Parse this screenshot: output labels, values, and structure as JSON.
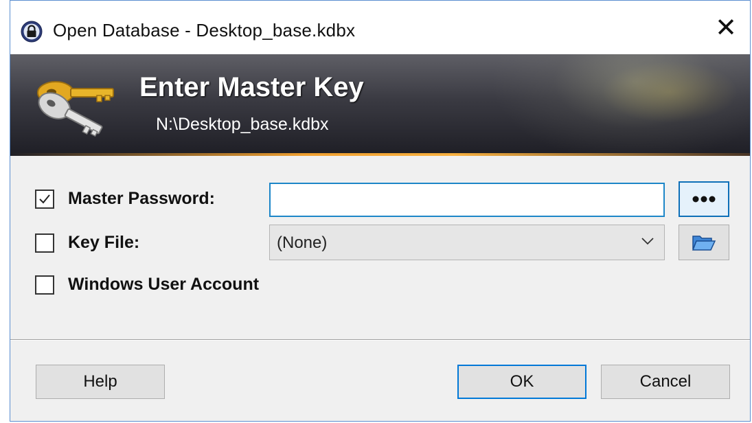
{
  "window": {
    "title": "Open Database - Desktop_base.kdbx",
    "close_glyph": "✕"
  },
  "banner": {
    "heading": "Enter Master Key",
    "path": "N:\\Desktop_base.kdbx"
  },
  "fields": {
    "master_password": {
      "label": "Master Password:",
      "checked": true,
      "value": "",
      "reveal_icon": "dots-icon"
    },
    "key_file": {
      "label": "Key File:",
      "checked": false,
      "selected": "(None)",
      "browse_icon": "folder-open-icon"
    },
    "windows_account": {
      "label": "Windows User Account",
      "checked": false
    }
  },
  "buttons": {
    "help": "Help",
    "ok": "OK",
    "cancel": "Cancel"
  },
  "colors": {
    "accent_blue": "#0078d7",
    "banner_dark": "#1e1e25",
    "banner_orange": "#f0a030"
  }
}
